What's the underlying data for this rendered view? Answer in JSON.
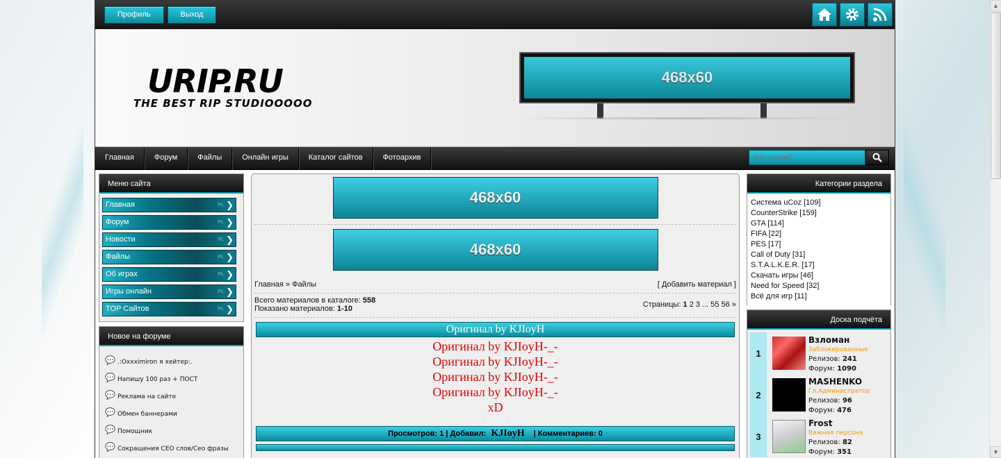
{
  "topbar": {
    "profile": "Профиль",
    "logout": "Выход",
    "icons": [
      "home-icon",
      "gear-icon",
      "rss-icon"
    ]
  },
  "header": {
    "logo": "URIP.RU",
    "tagline": "THE BEST RIP STUDIOOOOO",
    "banner": "468x60"
  },
  "nav": {
    "items": [
      "Главная",
      "Форум",
      "Файлы",
      "Онлайн игры",
      "Каталог сайтов",
      "Фотоархив"
    ],
    "search_placeholder": "Что ищем?"
  },
  "site_menu": {
    "title": "Меню сайта",
    "items": [
      "Главная",
      "Форум",
      "Новости",
      "Файлы",
      "Об играх",
      "Игры онлайн",
      "TOP Сайтов"
    ],
    "badge": "PL"
  },
  "forum_new": {
    "title": "Новое на форуме",
    "items": [
      ".:Oxxximiron я хейтер:.",
      "Напишу 100 раз + ПОСТ",
      "Реклама на сайте",
      "Обмен баннерами",
      "Помощник",
      "Сокращения СЕО слов/Сео фразы"
    ]
  },
  "center": {
    "banner1": "468x60",
    "banner2": "468x60",
    "breadcrumb": "Главная » Файлы",
    "add_material": "[ Добавить материал ]",
    "total_label": "Всего материалов в каталоге:",
    "total_value": "558",
    "shown_label": "Показано материалов:",
    "shown_value": "1-10",
    "pages_label": "Страницы:",
    "page_current": "1",
    "pages_rest": "2 3 ... 55 56 »",
    "entry_title": "Оригинал by KJIoyH",
    "entry_lines": [
      "Оригинал by KJIoyH-_-",
      "Оригинал by KJIoyH-_-",
      "Оригинал by KJIoyH-_-",
      "Оригинал by KJIoyH-_-",
      "xD"
    ],
    "views": "Просмотров: 1 | Добавил:",
    "author": "KJIoyH",
    "comments": "| Комментариев: 0"
  },
  "categories": {
    "title": "Категории раздела",
    "items": [
      "Система uCoz [109]",
      "CounterStrike [159]",
      "GTA [114]",
      "FIFA [22]",
      "PES [17]",
      "Call of Duty [31]",
      "S.T.A.L.K.E.R. [17]",
      "Скачать игры [46]",
      "Need for Speed [32]",
      "Всё для игр [11]"
    ]
  },
  "leaderboard": {
    "title": "Доска подчёта",
    "entries": [
      {
        "rank": "1",
        "name": "Взломан",
        "role": "Заблокированные",
        "releases_label": "Релизов:",
        "releases": "241",
        "forum_label": "Форум:",
        "forum": "1090"
      },
      {
        "rank": "2",
        "name": "MASHENKO",
        "role": "Гл.Администратор",
        "releases_label": "Релизов:",
        "releases": "96",
        "forum_label": "Форум:",
        "forum": "476"
      },
      {
        "rank": "3",
        "name": "Frost",
        "role": "Важная персона",
        "releases_label": "Релизов:",
        "releases": "82",
        "forum_label": "Форум:",
        "forum": "351"
      }
    ]
  }
}
